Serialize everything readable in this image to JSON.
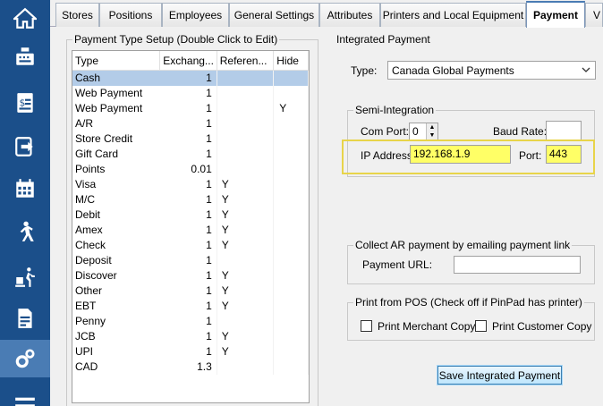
{
  "sidebar": {
    "items": [
      {
        "icon": "home-icon"
      },
      {
        "icon": "cash-register-icon"
      },
      {
        "icon": "invoice-icon"
      },
      {
        "icon": "logout-icon"
      },
      {
        "icon": "calendar-icon"
      },
      {
        "icon": "walking-person-icon"
      },
      {
        "icon": "delivery-icon"
      },
      {
        "icon": "report-icon"
      },
      {
        "icon": "settings-gear-icon",
        "active": true
      },
      {
        "icon": "menu-icon"
      }
    ]
  },
  "tabs": [
    {
      "label": "Stores"
    },
    {
      "label": "Positions"
    },
    {
      "label": "Employees"
    },
    {
      "label": "General Settings"
    },
    {
      "label": "Attributes"
    },
    {
      "label": "Printers and Local Equipment"
    },
    {
      "label": "Payment",
      "active": true
    },
    {
      "label": "V"
    }
  ],
  "payment_setup": {
    "title": "Payment Type Setup (Double Click to Edit)",
    "columns": [
      "Type",
      "Exchang...",
      "Referen...",
      "Hide"
    ],
    "rows": [
      {
        "type": "Cash",
        "exchange": "1",
        "reference": "",
        "hide": "",
        "selected": true
      },
      {
        "type": "Web Payment",
        "exchange": "1",
        "reference": "",
        "hide": ""
      },
      {
        "type": "Web Payment",
        "exchange": "1",
        "reference": "",
        "hide": "Y"
      },
      {
        "type": "A/R",
        "exchange": "1",
        "reference": "",
        "hide": ""
      },
      {
        "type": "Store Credit",
        "exchange": "1",
        "reference": "",
        "hide": ""
      },
      {
        "type": "Gift Card",
        "exchange": "1",
        "reference": "",
        "hide": ""
      },
      {
        "type": "Points",
        "exchange": "0.01",
        "reference": "",
        "hide": ""
      },
      {
        "type": "Visa",
        "exchange": "1",
        "reference": "Y",
        "hide": ""
      },
      {
        "type": "M/C",
        "exchange": "1",
        "reference": "Y",
        "hide": ""
      },
      {
        "type": "Debit",
        "exchange": "1",
        "reference": "Y",
        "hide": ""
      },
      {
        "type": "Amex",
        "exchange": "1",
        "reference": "Y",
        "hide": ""
      },
      {
        "type": "Check",
        "exchange": "1",
        "reference": "Y",
        "hide": ""
      },
      {
        "type": "Deposit",
        "exchange": "1",
        "reference": "",
        "hide": ""
      },
      {
        "type": "Discover",
        "exchange": "1",
        "reference": "Y",
        "hide": ""
      },
      {
        "type": "Other",
        "exchange": "1",
        "reference": "Y",
        "hide": ""
      },
      {
        "type": "EBT",
        "exchange": "1",
        "reference": "Y",
        "hide": ""
      },
      {
        "type": "Penny",
        "exchange": "1",
        "reference": "",
        "hide": ""
      },
      {
        "type": "JCB",
        "exchange": "1",
        "reference": "Y",
        "hide": ""
      },
      {
        "type": "UPI",
        "exchange": "1",
        "reference": "Y",
        "hide": ""
      },
      {
        "type": "CAD",
        "exchange": "1.3",
        "reference": "",
        "hide": ""
      }
    ]
  },
  "integrated": {
    "title": "Integrated Payment",
    "type_label": "Type:",
    "type_value": "Canada Global Payments",
    "semi": {
      "title": "Semi-Integration",
      "com_port_label": "Com Port:",
      "com_port_value": "0",
      "baud_rate_label": "Baud Rate:",
      "baud_rate_value": "",
      "ip_label": "IP Address:",
      "ip_value": "192.168.1.9",
      "port_label": "Port:",
      "port_value": "443"
    },
    "collect_ar": {
      "title": "Collect AR payment by emailing payment link",
      "url_label": "Payment URL:",
      "url_value": ""
    },
    "print": {
      "title": "Print from POS (Check off if PinPad has printer)",
      "merchant_label": "Print Merchant Copy",
      "customer_label": "Print Customer Copy"
    },
    "save_label": "Save Integrated Payment"
  }
}
